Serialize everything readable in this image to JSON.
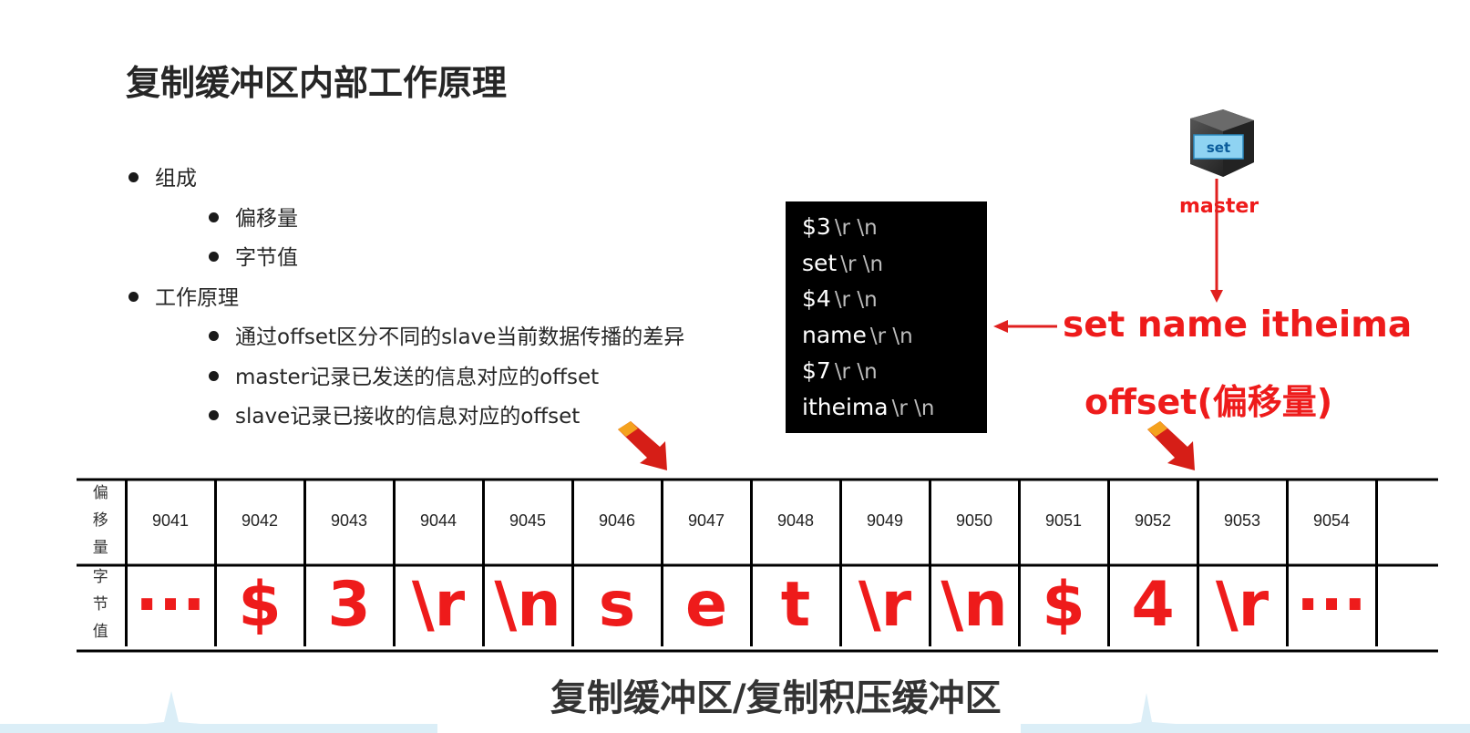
{
  "title": "复制缓冲区内部工作原理",
  "bullets": {
    "composition": "组成",
    "offset": "偏移量",
    "byte_value": "字节值",
    "working": "工作原理",
    "w1": "通过offset区分不同的slave当前数据传播的差异",
    "w2": "master记录已发送的信息对应的offset",
    "w3": "slave记录已接收的信息对应的offset"
  },
  "server": {
    "badge": "set",
    "label": "master",
    "icon": "server-icon"
  },
  "command_box": {
    "lines": [
      {
        "main": "$3",
        "esc": "\\r \\n"
      },
      {
        "main": "set",
        "esc": "\\r \\n"
      },
      {
        "main": "$4",
        "esc": "\\r \\n"
      },
      {
        "main": "name",
        "esc": "\\r \\n"
      },
      {
        "main": "$7",
        "esc": "\\r \\n"
      },
      {
        "main": "itheima",
        "esc": "\\r \\n"
      }
    ]
  },
  "command_text": "set name itheima",
  "offset_label": "offset(偏移量)",
  "table": {
    "offset_label_chars": [
      "偏",
      "移",
      "量"
    ],
    "byte_label_chars": [
      "字",
      "节",
      "值"
    ],
    "offsets": [
      "9041",
      "9042",
      "9043",
      "9044",
      "9045",
      "9046",
      "9047",
      "9048",
      "9049",
      "9050",
      "9051",
      "9052",
      "9053",
      "9054",
      ""
    ],
    "bytes": [
      "···",
      "$",
      "3",
      "\\r",
      "\\n",
      "s",
      "e",
      "t",
      "\\r",
      "\\n",
      "$",
      "4",
      "\\r",
      "···",
      ""
    ]
  },
  "caption": "复制缓冲区/复制积压缓冲区",
  "colors": {
    "accent_red": "#ee1b1b",
    "box_bg": "#000000",
    "text_dark": "#262626"
  }
}
